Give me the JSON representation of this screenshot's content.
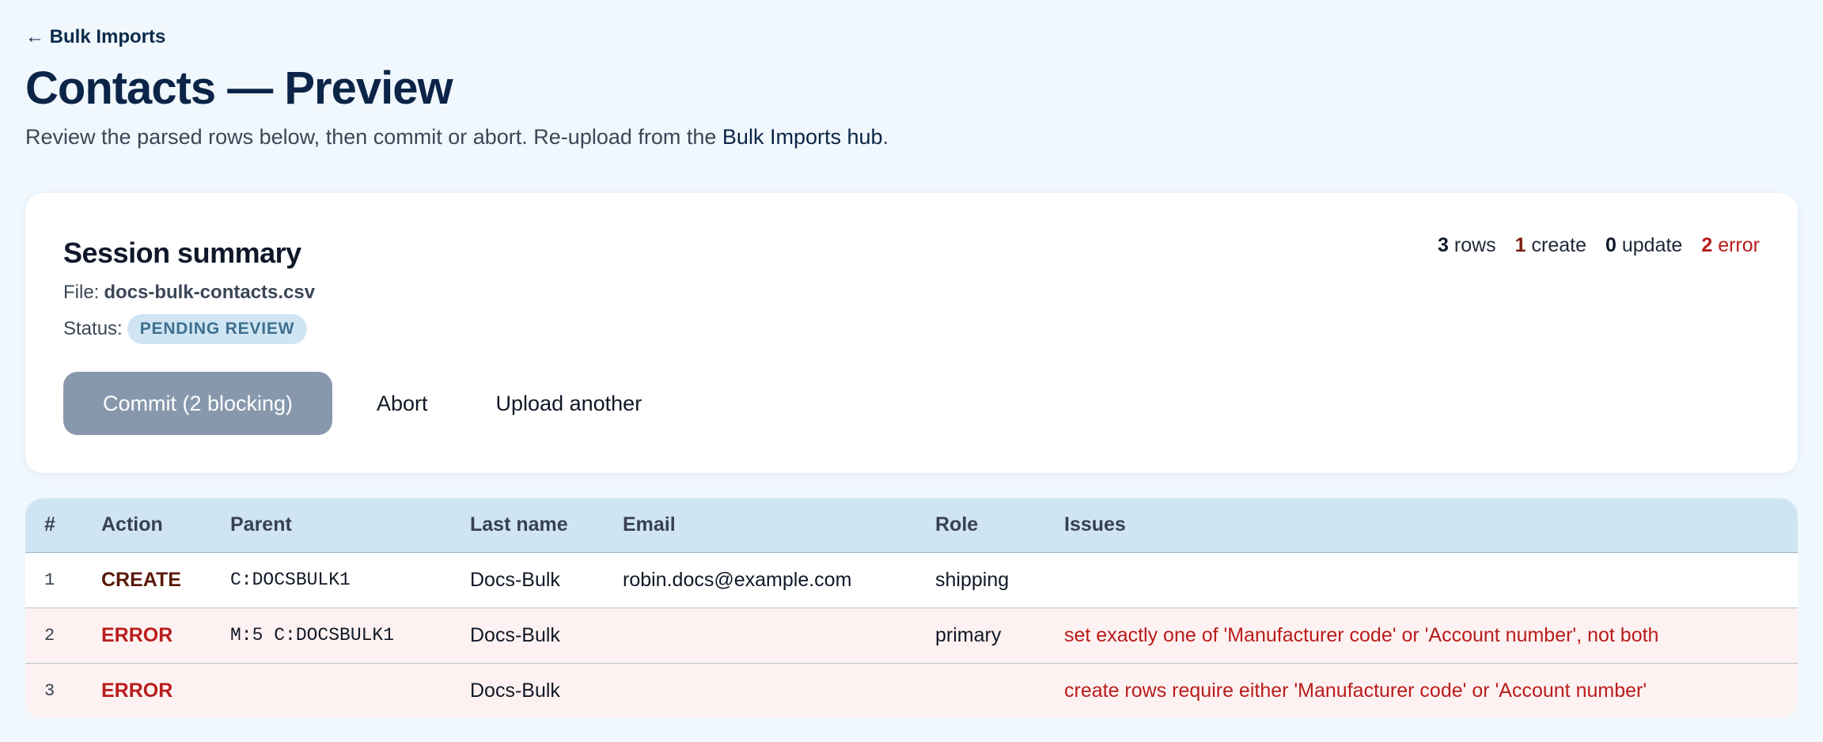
{
  "nav": {
    "back_label": "← Bulk Imports"
  },
  "header": {
    "title": "Contacts — Preview",
    "subtitle_prefix": "Review the parsed rows below, then commit or abort. Re-upload from the ",
    "subtitle_link": "Bulk Imports hub",
    "subtitle_suffix": "."
  },
  "session": {
    "title": "Session summary",
    "file_label": "File:",
    "file_name": "docs-bulk-contacts.csv",
    "status_label": "Status:",
    "status_badge": "PENDING REVIEW",
    "counts": {
      "rows_n": "3",
      "rows_label": "rows",
      "create_n": "1",
      "create_label": "create",
      "update_n": "0",
      "update_label": "update",
      "error_n": "2",
      "error_label": "error"
    },
    "buttons": {
      "commit": "Commit (2 blocking)",
      "abort": "Abort",
      "upload": "Upload another"
    }
  },
  "table": {
    "headers": [
      "#",
      "Action",
      "Parent",
      "Last name",
      "Email",
      "Role",
      "Issues"
    ],
    "rows": [
      {
        "num": "1",
        "action": "CREATE",
        "parent": "C:DOCSBULK1",
        "last_name": "Docs-Bulk",
        "email": "robin.docs@example.com",
        "role": "shipping",
        "issues": ""
      },
      {
        "num": "2",
        "action": "ERROR",
        "parent": "M:5 C:DOCSBULK1",
        "last_name": "Docs-Bulk",
        "email": "",
        "role": "primary",
        "issues": "set exactly one of 'Manufacturer code' or 'Account number', not both"
      },
      {
        "num": "3",
        "action": "ERROR",
        "parent": "",
        "last_name": "Docs-Bulk",
        "email": "",
        "role": "",
        "issues": "create rows require either 'Manufacturer code' or 'Account number'"
      }
    ]
  },
  "colors": {
    "background": "#f0f7fd",
    "title": "#0b2447",
    "commit_disabled": "#8798ad",
    "badge_bg": "#cfe5f3",
    "error": "#b91c1c",
    "create": "#5a1a0a"
  }
}
